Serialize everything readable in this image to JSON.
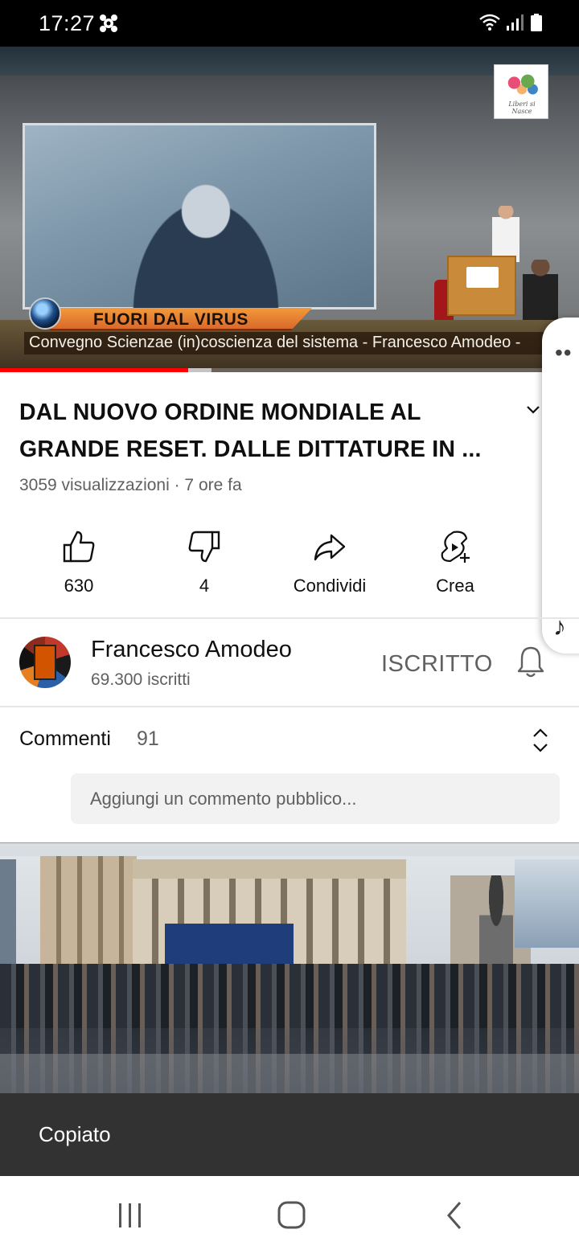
{
  "status_bar": {
    "time": "17:27",
    "app_icon": "brain-icon",
    "icons": [
      "wifi-icon",
      "signal-icon",
      "battery-icon"
    ]
  },
  "player": {
    "banner_title": "FUORI DAL VIRUS",
    "banner_subtitle": "Convegno Scienzae (in)coscienza del sistema - Francesco Amodeo -",
    "watermark_text": "Liberi si Nasce",
    "progress": 0.325,
    "buffered": 0.365
  },
  "video": {
    "title": "DAL NUOVO ORDINE MONDIALE AL GRANDE RESET. DALLE DITTATURE IN ...",
    "meta": "3059 visualizzazioni · 7 ore fa"
  },
  "actions": [
    {
      "icon": "thumbs-up-icon",
      "label": "630"
    },
    {
      "icon": "thumbs-down-icon",
      "label": "4"
    },
    {
      "icon": "share-icon",
      "label": "Condividi"
    },
    {
      "icon": "create-icon",
      "label": "Crea"
    }
  ],
  "channel": {
    "name": "Francesco Amodeo",
    "subscribers": "69.300 iscritti",
    "subscribe_label": "ISCRITTO"
  },
  "comments": {
    "label": "Commenti",
    "count": "91",
    "placeholder": "Aggiungi un commento pubblico..."
  },
  "toast": {
    "text": "Copiato"
  },
  "colors": {
    "progress": "#ff0000",
    "toast_bg": "#323232",
    "secondary_text": "#606060"
  }
}
